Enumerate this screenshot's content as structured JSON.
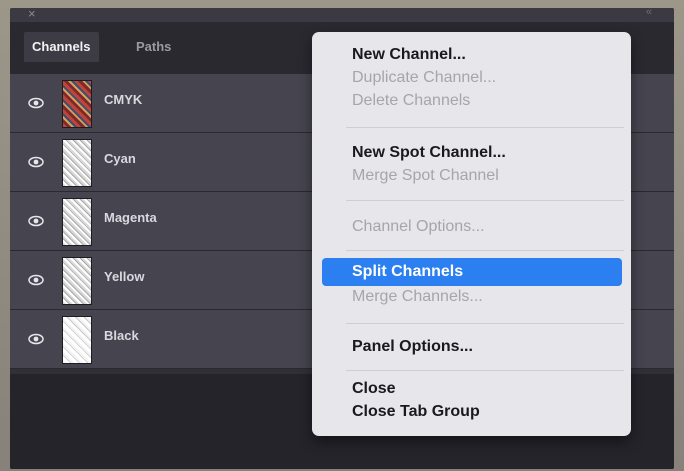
{
  "panel": {
    "close_glyph": "×",
    "collapse_glyph": "«",
    "tabs": [
      {
        "label": "Channels"
      },
      {
        "label": "Paths"
      }
    ],
    "channels": [
      {
        "label": "CMYK",
        "visible": true
      },
      {
        "label": "Cyan",
        "visible": true
      },
      {
        "label": "Magenta",
        "visible": true
      },
      {
        "label": "Yellow",
        "visible": true
      },
      {
        "label": "Black",
        "visible": true
      }
    ]
  },
  "menu": {
    "items": [
      {
        "label": "New Channel...",
        "enabled": true
      },
      {
        "label": "Duplicate Channel...",
        "enabled": false
      },
      {
        "label": "Delete Channels",
        "enabled": false
      },
      {
        "label": "New Spot Channel...",
        "enabled": true
      },
      {
        "label": "Merge Spot Channel",
        "enabled": false
      },
      {
        "label": "Channel Options...",
        "enabled": false
      },
      {
        "label": "Split Channels",
        "enabled": true,
        "highlighted": true
      },
      {
        "label": "Merge Channels...",
        "enabled": false
      },
      {
        "label": "Panel Options...",
        "enabled": true
      },
      {
        "label": "Close",
        "enabled": true
      },
      {
        "label": "Close Tab Group",
        "enabled": true
      }
    ]
  },
  "colors": {
    "panel_bg": "#313039",
    "menu_bg": "#e7e6ea",
    "highlight": "#2b7ff0",
    "disabled_text": "#a6a5ab"
  }
}
